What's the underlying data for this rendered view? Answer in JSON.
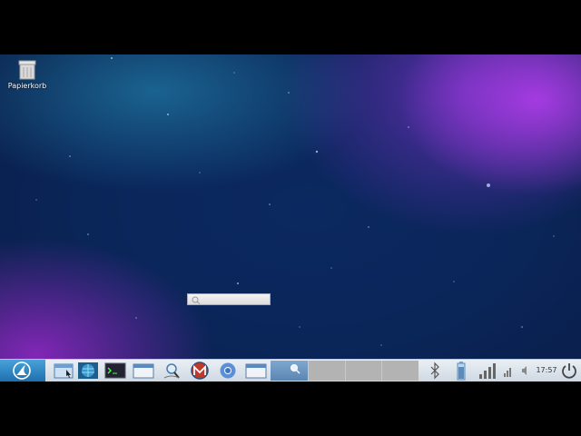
{
  "desktop": {
    "trash_label": "Papierkorb"
  },
  "taskbar": {
    "clock": "17:57",
    "launchers": [
      {
        "icon": "file-manager-icon"
      },
      {
        "icon": "network-globe-icon"
      },
      {
        "icon": "terminal-icon"
      },
      {
        "icon": "window-icon"
      },
      {
        "icon": "search-magnifier-icon"
      },
      {
        "icon": "mail-client-icon"
      },
      {
        "icon": "chromium-browser-icon"
      },
      {
        "icon": "window-icon"
      }
    ],
    "tray": [
      {
        "icon": "bluetooth-icon"
      },
      {
        "icon": "battery-icon"
      },
      {
        "icon": "signal-strength-icon"
      },
      {
        "icon": "network-icon"
      },
      {
        "icon": "volume-icon"
      },
      {
        "icon": "power-icon"
      }
    ]
  },
  "colors": {
    "start_button": "#1d6fae",
    "active_task": "#6b96c2",
    "idle_task": "#b3b3b3"
  }
}
